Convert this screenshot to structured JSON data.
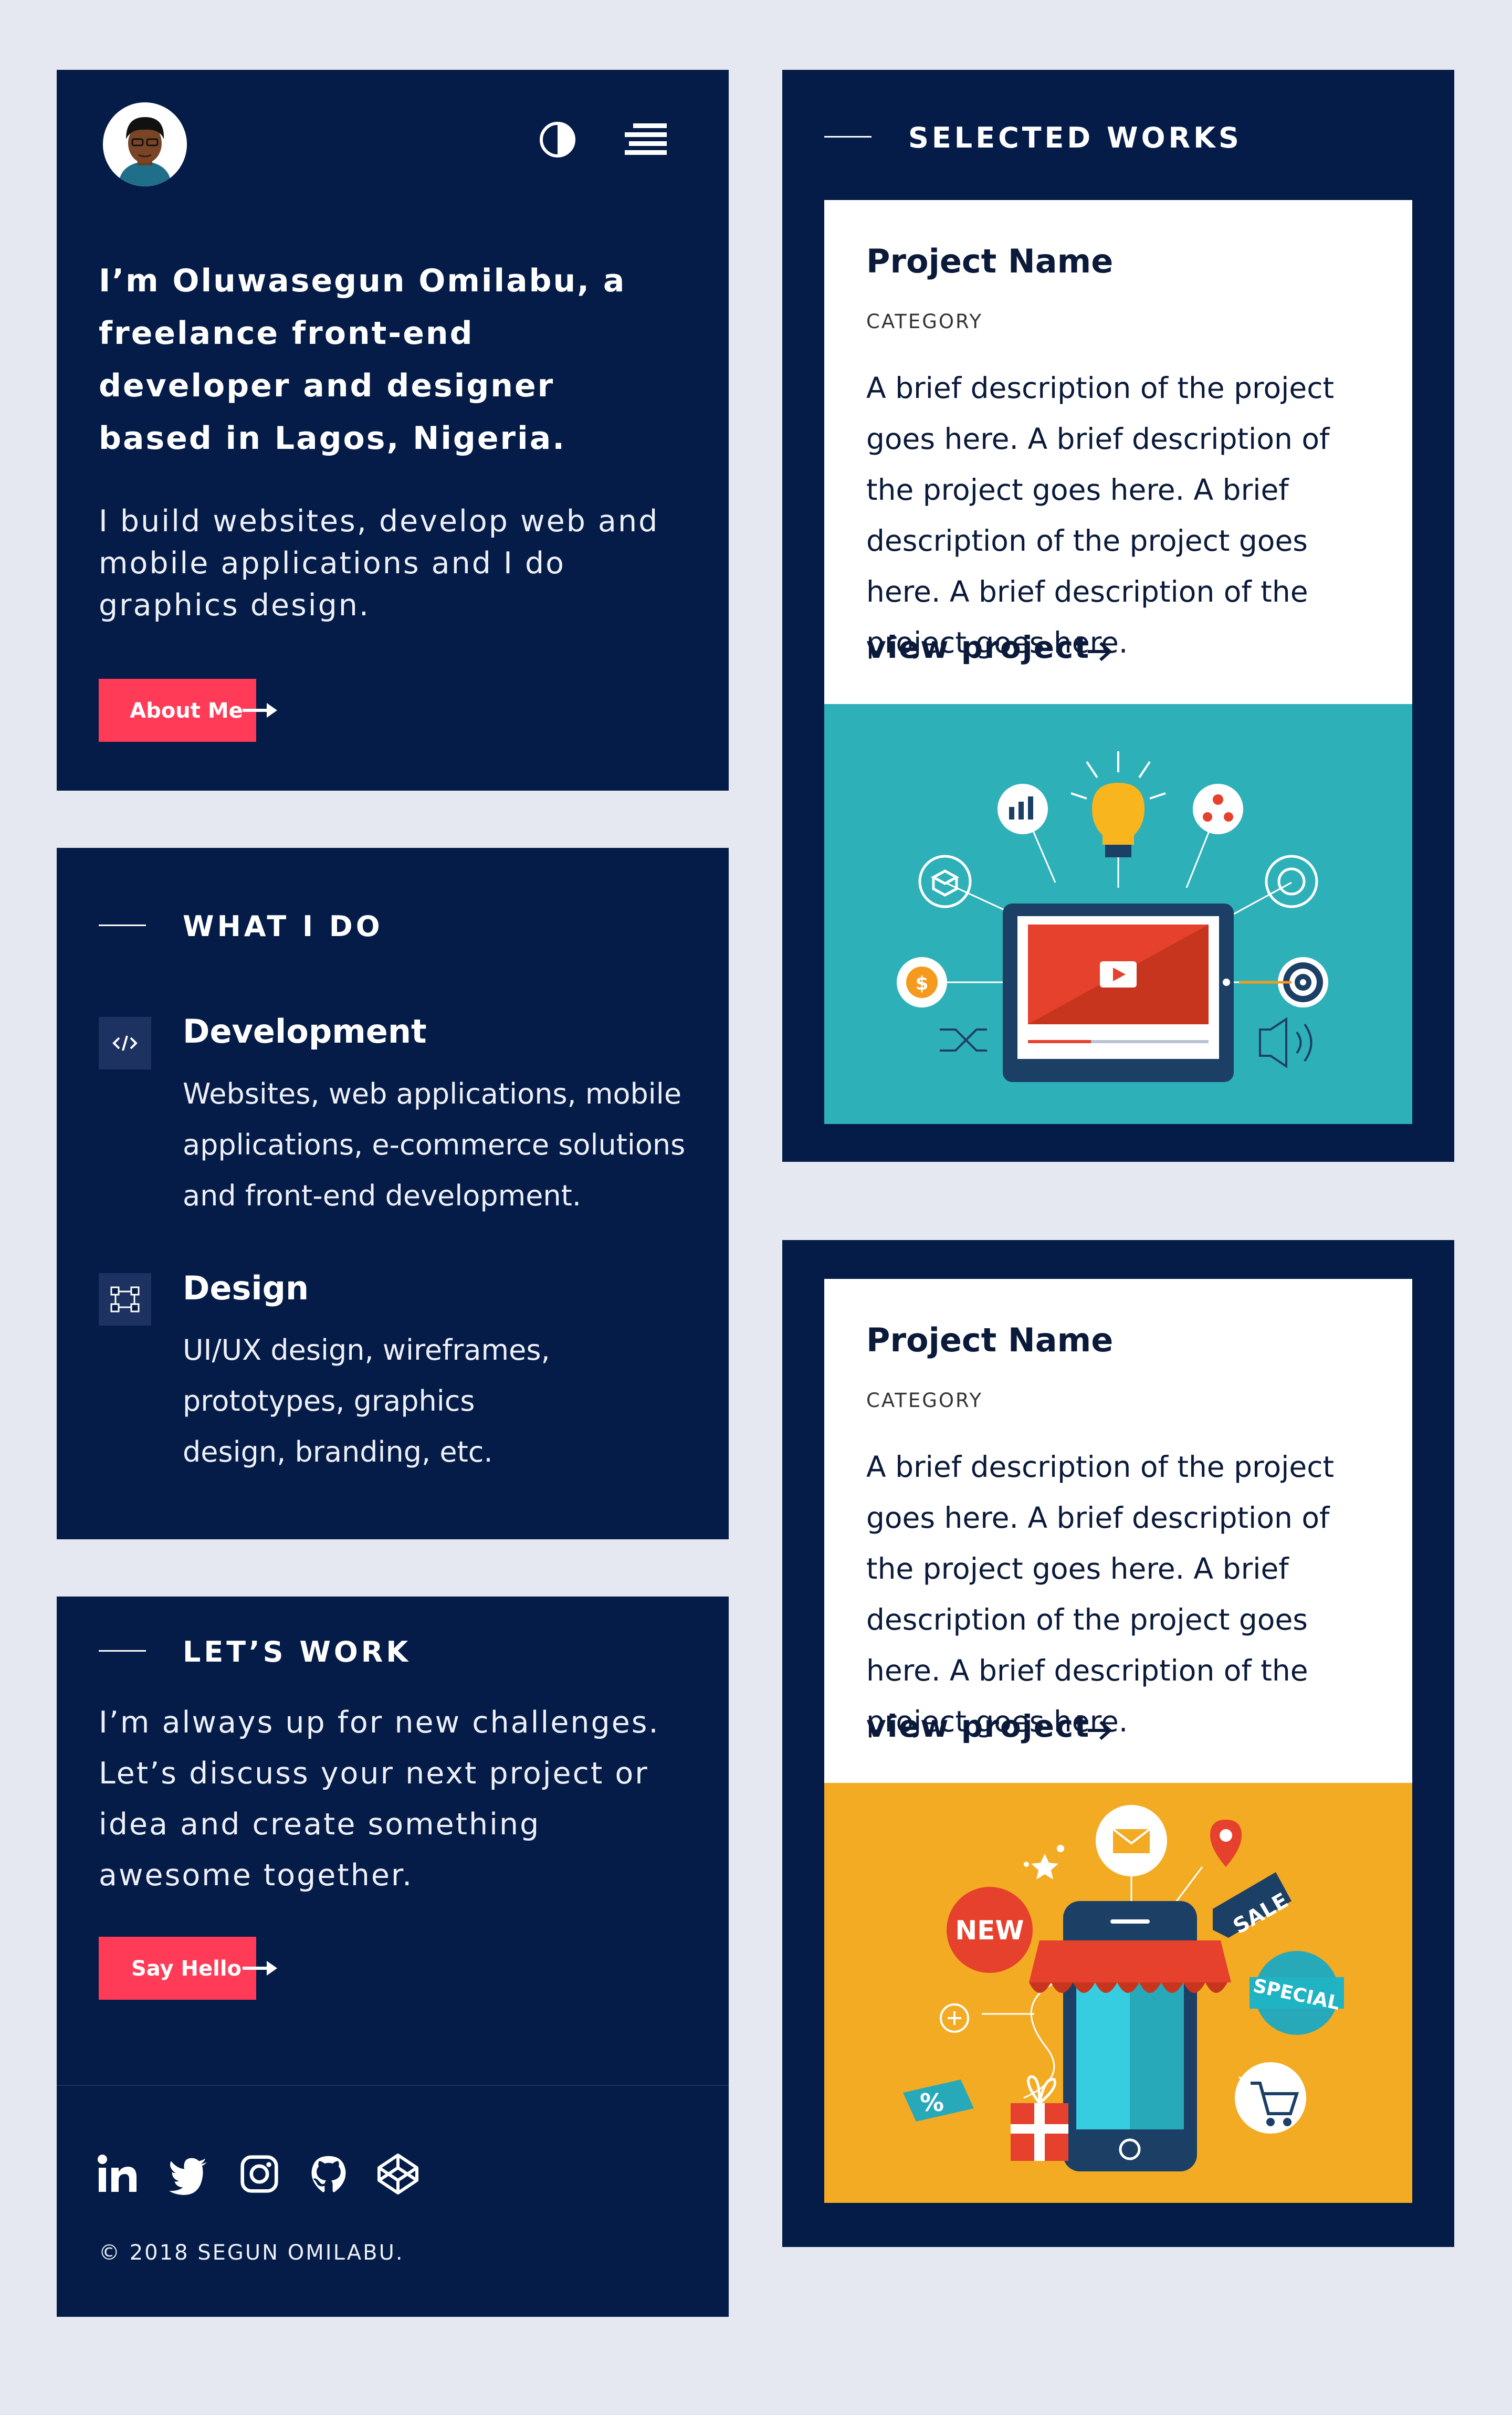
{
  "colors": {
    "page_bg": "#e6e8f1",
    "panel_bg": "#041c47",
    "accent": "#ff3b58",
    "card_bg": "#ffffff"
  },
  "intro": {
    "heading": "I’m Oluwasegun Omilabu, a freelance front-end developer and designer based in Lagos, Nigeria.",
    "text": "I build websites, develop web and mobile applications and I do graphics design.",
    "button_label": "About Me",
    "icons": [
      "avatar",
      "contrast-toggle-icon",
      "menu-icon"
    ]
  },
  "what_i_do": {
    "title": "WHAT I DO",
    "services": [
      {
        "icon": "code-icon",
        "title": "Development",
        "description": "Websites, web applications, mobile applications, e-commerce solutions and front-end development."
      },
      {
        "icon": "vector-design-icon",
        "title": "Design",
        "description": "UI/UX design, wireframes, prototypes, graphics design, branding, etc."
      }
    ]
  },
  "lets_work": {
    "title": "LET’S WORK",
    "text": "I’m always up for new challenges. Let’s discuss your next project or idea and create something awesome together.",
    "button_label": "Say Hello",
    "social": [
      "linkedin-icon",
      "twitter-icon",
      "instagram-icon",
      "github-icon",
      "codepen-icon"
    ],
    "copyright": "© 2018 SEGUN OMILABU."
  },
  "selected_works": {
    "title": "SELECTED WORKS",
    "projects": [
      {
        "name": "Project Name",
        "category": "CATEGORY",
        "description": "A brief description of the project goes here. A brief description of the project goes here. A brief description of the project goes here. A brief description of the project goes here.",
        "link_label": "view project",
        "image": "digital-marketing-illustration"
      },
      {
        "name": "Project Name",
        "category": "CATEGORY",
        "description": "A brief description of the project goes here. A brief description of the project goes here. A brief description of the project goes here. A brief description of the project goes here.",
        "link_label": "view project",
        "image": "ecommerce-illustration"
      }
    ]
  }
}
